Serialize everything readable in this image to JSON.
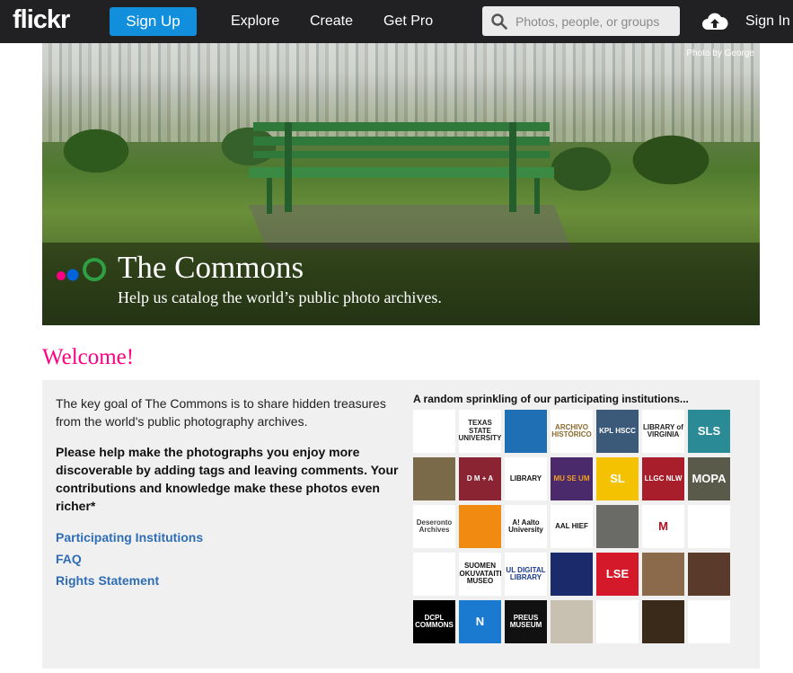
{
  "header": {
    "logo": "flickr",
    "signup": "Sign Up",
    "nav": [
      "Explore",
      "Create",
      "Get Pro"
    ],
    "search_placeholder": "Photos, people, or groups",
    "signin": "Sign In"
  },
  "hero": {
    "credit": "Photo by George",
    "title": "The Commons",
    "subtitle": "Help us catalog the world’s public photo archives."
  },
  "main": {
    "welcome": "Welcome!",
    "intro": "The key goal of The Commons is to share hidden treasures from the world's public photography archives.",
    "callout": "Please help make the photographs you enjoy more discoverable by adding tags and leaving comments. Your contributions and knowledge make these photos even richer*",
    "links": [
      "Participating Institutions",
      "FAQ",
      "Rights Statement"
    ],
    "institutions_title": "A random sprinkling of our participating institutions...",
    "tiles": [
      {
        "text": "",
        "bg": "#ffffff",
        "fg": "#000000"
      },
      {
        "text": "TEXAS STATE UNIVERSITY",
        "bg": "#ffffff",
        "fg": "#222222"
      },
      {
        "text": "",
        "bg": "#1e6fb4",
        "fg": "#ffffff"
      },
      {
        "text": "ARCHIVO HISTÓRICO",
        "bg": "#ffffff",
        "fg": "#8a6a2a"
      },
      {
        "text": "KPL HSCC",
        "bg": "#3b5a7a",
        "fg": "#ffffff"
      },
      {
        "text": "LIBRARY of VIRGINIA",
        "bg": "#ffffff",
        "fg": "#222222"
      },
      {
        "text": "SLS",
        "bg": "#2a8a96",
        "fg": "#ffffff"
      },
      {
        "text": "",
        "bg": "#7a6a4a",
        "fg": "#ffffff"
      },
      {
        "text": "D M + A",
        "bg": "#8a2432",
        "fg": "#ffffff"
      },
      {
        "text": "LIBRARY",
        "bg": "#ffffff",
        "fg": "#111111"
      },
      {
        "text": "MU SE UM",
        "bg": "#4a2a6a",
        "fg": "#f2a020"
      },
      {
        "text": "SL",
        "bg": "#f4c200",
        "fg": "#ffffff"
      },
      {
        "text": "LLGC NLW",
        "bg": "#a81e2a",
        "fg": "#ffffff"
      },
      {
        "text": "MOPA",
        "bg": "#5a5a4a",
        "fg": "#ffffff"
      },
      {
        "text": "Deseronto Archives",
        "bg": "#ffffff",
        "fg": "#444444"
      },
      {
        "text": "",
        "bg": "#f08a10",
        "fg": "#ffffff"
      },
      {
        "text": "A! Aalto University",
        "bg": "#ffffff",
        "fg": "#111111"
      },
      {
        "text": "AAL HIEF",
        "bg": "#ffffff",
        "fg": "#111111"
      },
      {
        "text": "",
        "bg": "#6a6a66",
        "fg": "#ffffff"
      },
      {
        "text": "M",
        "bg": "#ffffff",
        "fg": "#b01020"
      },
      {
        "text": "",
        "bg": "#ffffff",
        "fg": "#777777"
      },
      {
        "text": "",
        "bg": "#ffffff",
        "fg": "#000000"
      },
      {
        "text": "SUOMEN VALOKUVATAITEEN MUSEO",
        "bg": "#ffffff",
        "fg": "#111111"
      },
      {
        "text": "UL DIGITAL LIBRARY",
        "bg": "#ffffff",
        "fg": "#1a3a8a"
      },
      {
        "text": "",
        "bg": "#1a2a6a",
        "fg": "#e0b020"
      },
      {
        "text": "LSE",
        "bg": "#d41a2a",
        "fg": "#ffffff"
      },
      {
        "text": "",
        "bg": "#8a6a4a",
        "fg": "#ffffff"
      },
      {
        "text": "",
        "bg": "#5a3a2a",
        "fg": "#ffffff"
      },
      {
        "text": "DCPL COMMONS",
        "bg": "#000000",
        "fg": "#ffffff"
      },
      {
        "text": "N",
        "bg": "#1a7ad0",
        "fg": "#ffffff"
      },
      {
        "text": "PREUS MUSEUM",
        "bg": "#111111",
        "fg": "#ffffff"
      },
      {
        "text": "",
        "bg": "#c8c0b0",
        "fg": "#ffffff"
      },
      {
        "text": "",
        "bg": "#ffffff",
        "fg": "#1a3a8a"
      },
      {
        "text": "",
        "bg": "#3a2a1a",
        "fg": "#f0c040"
      },
      {
        "text": "",
        "bg": "#ffffff",
        "fg": "#c01020"
      }
    ]
  }
}
